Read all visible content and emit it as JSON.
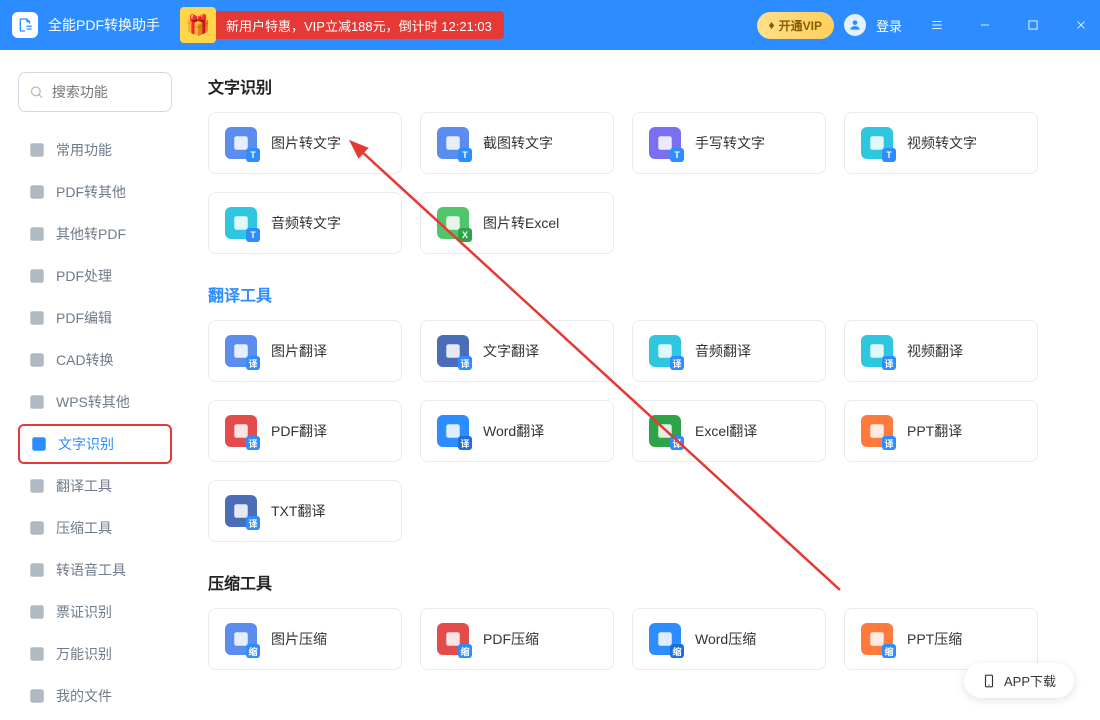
{
  "titlebar": {
    "app_title": "全能PDF转换助手",
    "promo_text": "新用户特惠，VIP立减188元，倒计时 12:21:03",
    "vip_label": "开通VIP",
    "login_label": "登录"
  },
  "sidebar": {
    "search_placeholder": "搜索功能",
    "items": [
      {
        "label": "常用功能"
      },
      {
        "label": "PDF转其他"
      },
      {
        "label": "其他转PDF"
      },
      {
        "label": "PDF处理"
      },
      {
        "label": "PDF编辑"
      },
      {
        "label": "CAD转换"
      },
      {
        "label": "WPS转其他"
      },
      {
        "label": "文字识别"
      },
      {
        "label": "翻译工具"
      },
      {
        "label": "压缩工具"
      },
      {
        "label": "转语音工具"
      },
      {
        "label": "票证识别"
      },
      {
        "label": "万能识别"
      },
      {
        "label": "我的文件"
      }
    ],
    "active_index": 7
  },
  "sections": [
    {
      "title": "文字识别",
      "title_blue": false,
      "cards": [
        {
          "label": "图片转文字",
          "icon_bg": "#5b8def",
          "corner_bg": "#2d8cff",
          "corner_text": "T"
        },
        {
          "label": "截图转文字",
          "icon_bg": "#5b8def",
          "corner_bg": "#2d8cff",
          "corner_text": "T"
        },
        {
          "label": "手写转文字",
          "icon_bg": "#7a6ff0",
          "corner_bg": "#2d8cff",
          "corner_text": "T"
        },
        {
          "label": "视频转文字",
          "icon_bg": "#2fc6e0",
          "corner_bg": "#2d8cff",
          "corner_text": "T"
        },
        {
          "label": "音频转文字",
          "icon_bg": "#2fc6e0",
          "corner_bg": "#2d8cff",
          "corner_text": "T"
        },
        {
          "label": "图片转Excel",
          "icon_bg": "#52c46b",
          "corner_bg": "#2ea34a",
          "corner_text": "X"
        }
      ]
    },
    {
      "title": "翻译工具",
      "title_blue": true,
      "cards": [
        {
          "label": "图片翻译",
          "icon_bg": "#5b8def",
          "corner_bg": "#2d8cff",
          "corner_text": "译"
        },
        {
          "label": "文字翻译",
          "icon_bg": "#4b6cb7",
          "corner_bg": "#2d8cff",
          "corner_text": "译"
        },
        {
          "label": "音频翻译",
          "icon_bg": "#2fc6e0",
          "corner_bg": "#2d8cff",
          "corner_text": "译"
        },
        {
          "label": "视频翻译",
          "icon_bg": "#2fc6e0",
          "corner_bg": "#2d8cff",
          "corner_text": "译"
        },
        {
          "label": "PDF翻译",
          "icon_bg": "#e44b4b",
          "corner_bg": "#2d8cff",
          "corner_text": "译"
        },
        {
          "label": "Word翻译",
          "icon_bg": "#2d8cff",
          "corner_bg": "#1a6fe0",
          "corner_text": "译"
        },
        {
          "label": "Excel翻译",
          "icon_bg": "#2ea34a",
          "corner_bg": "#2d8cff",
          "corner_text": "译"
        },
        {
          "label": "PPT翻译",
          "icon_bg": "#ff7a3d",
          "corner_bg": "#2d8cff",
          "corner_text": "译"
        },
        {
          "label": "TXT翻译",
          "icon_bg": "#4b6cb7",
          "corner_bg": "#2d8cff",
          "corner_text": "译"
        }
      ]
    },
    {
      "title": "压缩工具",
      "title_blue": false,
      "cards": [
        {
          "label": "图片压缩",
          "icon_bg": "#5b8def",
          "corner_bg": "#2d8cff",
          "corner_text": "缩"
        },
        {
          "label": "PDF压缩",
          "icon_bg": "#e44b4b",
          "corner_bg": "#2d8cff",
          "corner_text": "缩"
        },
        {
          "label": "Word压缩",
          "icon_bg": "#2d8cff",
          "corner_bg": "#1a6fe0",
          "corner_text": "缩"
        },
        {
          "label": "PPT压缩",
          "icon_bg": "#ff7a3d",
          "corner_bg": "#2d8cff",
          "corner_text": "缩"
        }
      ]
    }
  ],
  "download_label": "APP下载"
}
